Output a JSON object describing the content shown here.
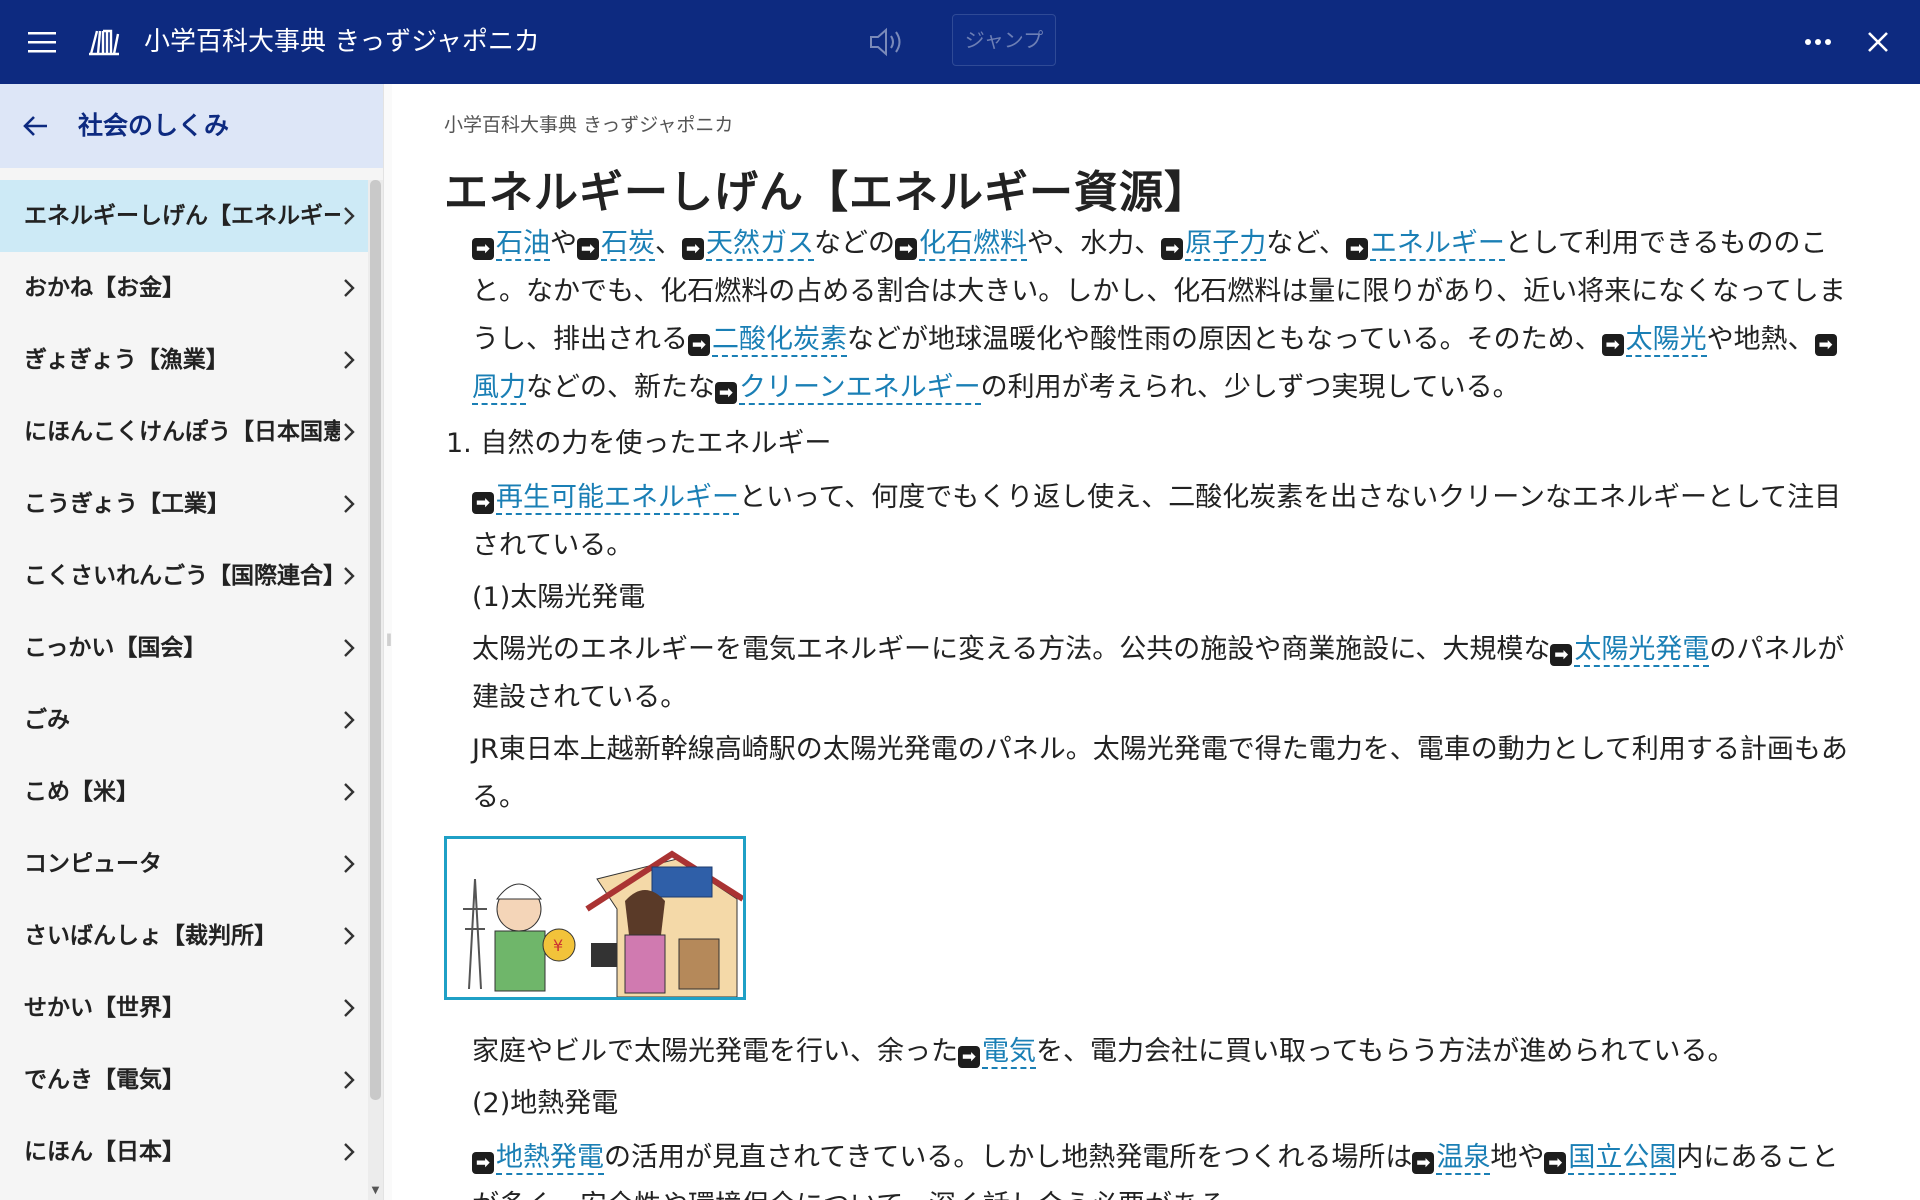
{
  "app": {
    "title": "小学百科大事典 きっずジャポニカ",
    "jump_label": "ジャンプ"
  },
  "sidebar": {
    "title": "社会のしくみ",
    "items": [
      {
        "label": "エネルギーしげん【エネルギー資源】",
        "selected": true
      },
      {
        "label": "おかね【お金】"
      },
      {
        "label": "ぎょぎょう【漁業】"
      },
      {
        "label": "にほんこくけんぽう【日本国憲法】"
      },
      {
        "label": "こうぎょう【工業】"
      },
      {
        "label": "こくさいれんごう【国際連合】"
      },
      {
        "label": "こっかい【国会】"
      },
      {
        "label": "ごみ"
      },
      {
        "label": "こめ【米】"
      },
      {
        "label": "コンピュータ"
      },
      {
        "label": "さいばんしょ【裁判所】"
      },
      {
        "label": "せかい【世界】"
      },
      {
        "label": "でんき【電気】"
      },
      {
        "label": "にほん【日本】"
      }
    ]
  },
  "article": {
    "breadcrumb": "小学百科大事典 きっずジャポニカ",
    "title": "エネルギーしげん【エネルギー資源】",
    "intro": {
      "link1": "石油",
      "t1": "や",
      "link2": "石炭",
      "t2": "、",
      "link3": "天然ガス",
      "t3": "などの",
      "link4": "化石燃料",
      "t4": "や、水力、",
      "link5": "原子力",
      "t5": "など、",
      "link6": "エネルギー",
      "t6": "として利用できるもののこと。なかでも、化石燃料の占める割合は大きい。しかし、化石燃料は量に限りがあり、近い将来になくなってしまうし、排出される",
      "link7": "二酸化炭素",
      "t7": "などが地球温暖化や酸性雨の原因ともなっている。そのため、",
      "link8": "太陽光",
      "t8": "や地熱、",
      "link9": "風力",
      "t9": "などの、新たな",
      "link10": "クリーンエネルギー",
      "t10": "の利用が考えられ、少しずつ実現している。"
    },
    "section1": {
      "heading": "1. 自然の力を使ったエネルギー",
      "link": "再生可能エネルギー",
      "text": "といって、何度でもくり返し使え、二酸化炭素を出さないクリーンなエネルギーとして注目されている。"
    },
    "solar": {
      "heading": "(1)太陽光発電",
      "p1_text": "太陽光のエネルギーを電気エネルギーに変える方法。公共の施設や商業施設に、大規模な",
      "p1_link": "太陽光発電",
      "p1_end": "のパネルが建設されている。",
      "p2_text": "JR東日本上越新幹線高崎駅の太陽光発電のパネル。太陽光発電で得た電力を、電車の動力として利用する計画もある。",
      "p3_text": "家庭やビルで太陽光発電を行い、余った",
      "p3_link": "電気",
      "p3_end": "を、電力会社に買い取ってもらう方法が進められている。"
    },
    "geo": {
      "heading": "(2)地熱発電",
      "link1": "地熱発電",
      "t1": "の活用が見直されてきている。しかし地熱発電所をつくれる場所は",
      "link2": "温泉",
      "t2": "地や",
      "link3": "国立公園",
      "t3": "内にあることが多く、安全性や環境保全について、深く話し合う必要がある。"
    }
  },
  "colors": {
    "titlebar": "#0d2a80",
    "selected": "#cdeaf6",
    "link": "#1a7fb5"
  }
}
